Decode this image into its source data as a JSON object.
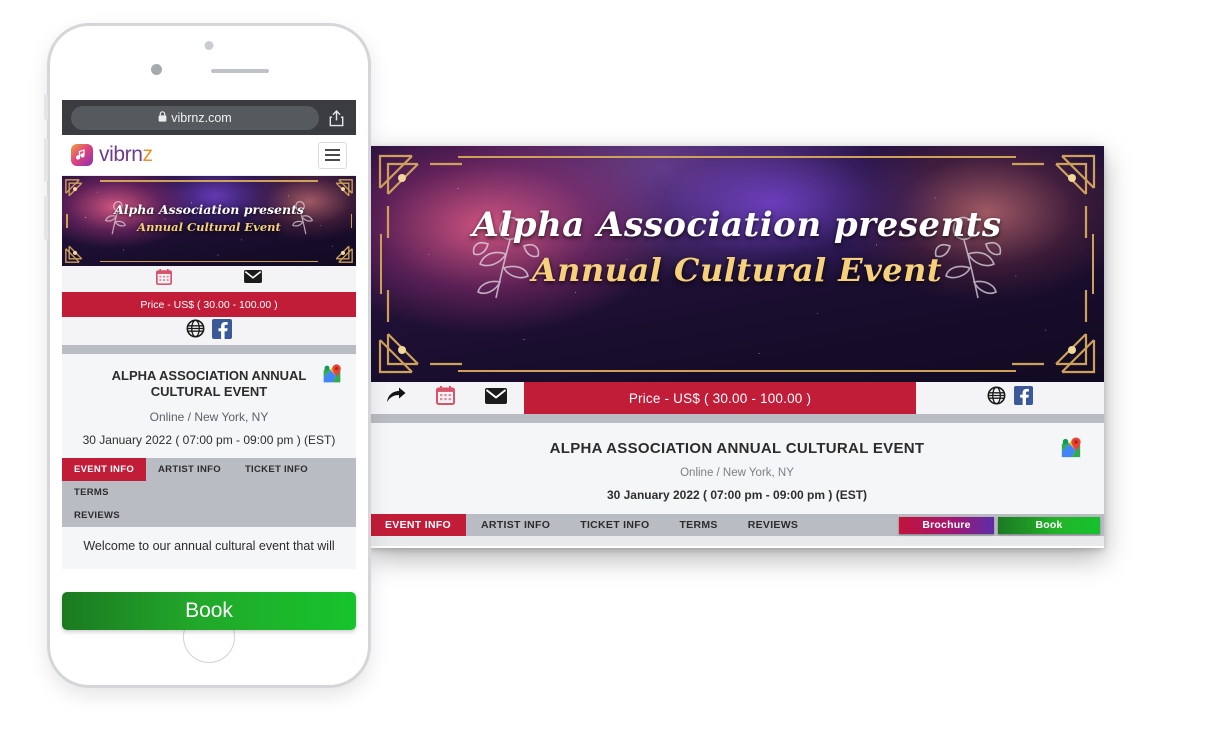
{
  "browser": {
    "url": "vibrnz.com",
    "lock_icon": "lock-icon",
    "share_icon": "share-icon"
  },
  "brand": {
    "name_primary": "vibrn",
    "name_accent": "z",
    "logo_icon": "vibrnz-logo-icon",
    "menu_icon": "hamburger-menu-icon"
  },
  "banner": {
    "line1": "Alpha Association presents",
    "line2": "Annual Cultural Event",
    "decor": "art-deco-gold-corner"
  },
  "actions": {
    "share_icon": "share-arrow-icon",
    "calendar_icon": "calendar-icon",
    "email_icon": "email-envelope-icon",
    "price_label": "Price - US$ ( 30.00 - 100.00 )",
    "website_icon": "globe-icon",
    "facebook_icon": "facebook-icon"
  },
  "event": {
    "title": "ALPHA ASSOCIATION ANNUAL CULTURAL EVENT",
    "location": "Online / New York, NY",
    "datetime": "30 January 2022 ( 07:00 pm - 09:00 pm ) (EST)",
    "map_icon": "google-maps-pin-icon"
  },
  "tabs": [
    {
      "label": "EVENT INFO",
      "active": true
    },
    {
      "label": "ARTIST INFO",
      "active": false
    },
    {
      "label": "TICKET INFO",
      "active": false
    },
    {
      "label": "TERMS",
      "active": false
    },
    {
      "label": "REVIEWS",
      "active": false
    }
  ],
  "buttons": {
    "brochure": "Brochure",
    "book": "Book",
    "book_mobile": "Book"
  },
  "content": {
    "description_excerpt": "Welcome to our annual cultural event that will"
  },
  "colors": {
    "accent_red": "#c21d38",
    "green": "#22a72a",
    "gray_bar": "#b9bcc2",
    "gold": "#cda15a",
    "purple": "#6c3b8e",
    "orange": "#e8922f"
  }
}
